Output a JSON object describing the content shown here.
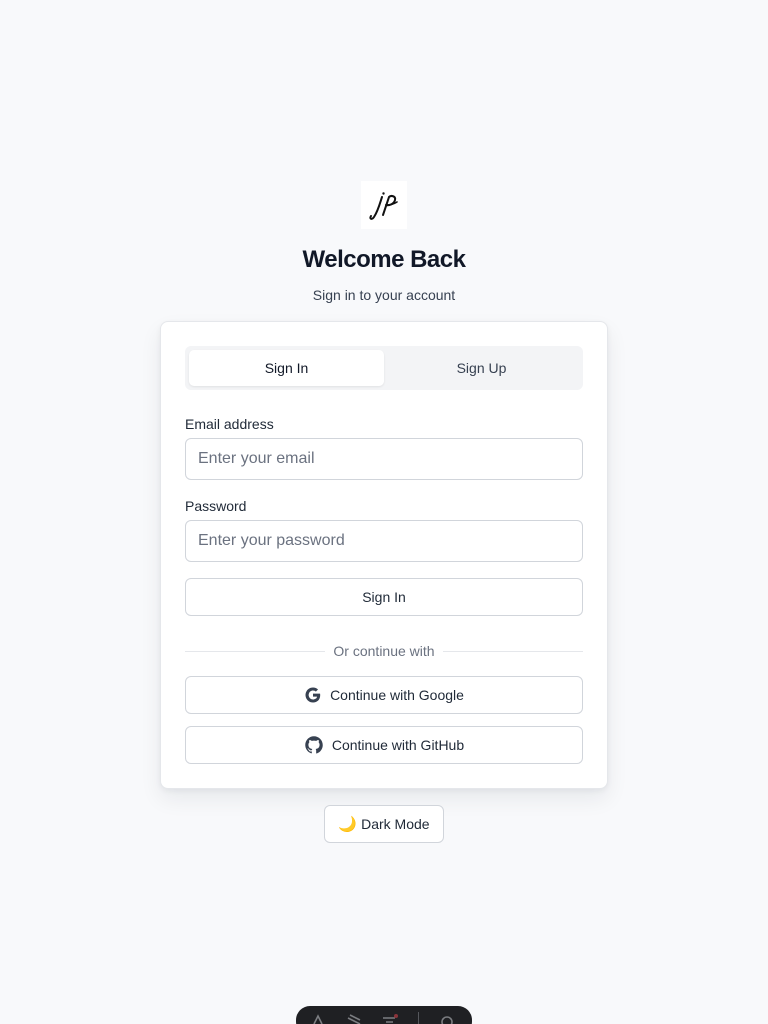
{
  "logo": {
    "icon": "jp-signature-logo"
  },
  "header": {
    "title": "Welcome Back",
    "subtitle": "Sign in to your account"
  },
  "tabs": [
    {
      "label": "Sign In",
      "active": true
    },
    {
      "label": "Sign Up",
      "active": false
    }
  ],
  "form": {
    "email_label": "Email address",
    "email_placeholder": "Enter your email",
    "email_value": "",
    "password_label": "Password",
    "password_placeholder": "Enter your password",
    "password_value": "",
    "submit_label": "Sign In"
  },
  "divider_text": "Or continue with",
  "social": {
    "google_label": "Continue with Google",
    "github_label": "Continue with GitHub"
  },
  "theme_toggle": {
    "icon": "moon-icon",
    "glyph": "🌙",
    "label": "Dark Mode"
  },
  "colors": {
    "background": "#f8f9fb",
    "card": "#ffffff",
    "border": "#d1d5db",
    "text": "#111827",
    "muted": "#6b7280",
    "dock": "#1f2023"
  }
}
